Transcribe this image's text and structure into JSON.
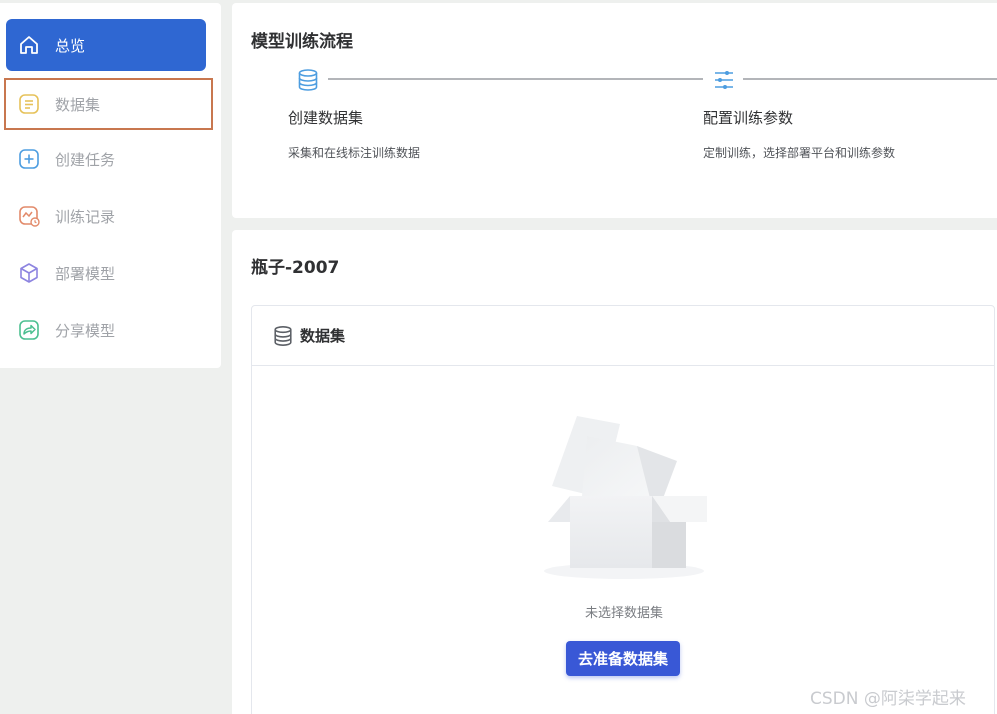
{
  "sidebar": {
    "items": [
      {
        "label": "总览",
        "icon": "home-icon",
        "active": true
      },
      {
        "label": "数据集",
        "icon": "document-icon",
        "active": false
      },
      {
        "label": "创建任务",
        "icon": "plus-icon",
        "active": false
      },
      {
        "label": "训练记录",
        "icon": "chart-clock-icon",
        "active": false
      },
      {
        "label": "部署模型",
        "icon": "cube-icon",
        "active": false
      },
      {
        "label": "分享模型",
        "icon": "share-icon",
        "active": false
      }
    ]
  },
  "workflow": {
    "title": "模型训练流程",
    "steps": [
      {
        "icon": "database-icon",
        "title": "创建数据集",
        "desc": "采集和在线标注训练数据"
      },
      {
        "icon": "sliders-icon",
        "title": "配置训练参数",
        "desc": "定制训练，选择部署平台和训练参数"
      }
    ]
  },
  "project": {
    "title": "瓶子-2007",
    "card": {
      "header_icon": "database-icon",
      "header": "数据集",
      "empty_text": "未选择数据集",
      "button": "去准备数据集"
    }
  },
  "watermark": "CSDN @阿柒学起来",
  "colors": {
    "accent": "#2f67d2",
    "button": "#3958d6",
    "outline": "#c8774f",
    "icon_yellow": "#e6c25a",
    "icon_blue": "#4d9de0",
    "icon_orange": "#e28a6a",
    "icon_purple": "#8d84e0",
    "icon_green": "#4cbf90"
  }
}
